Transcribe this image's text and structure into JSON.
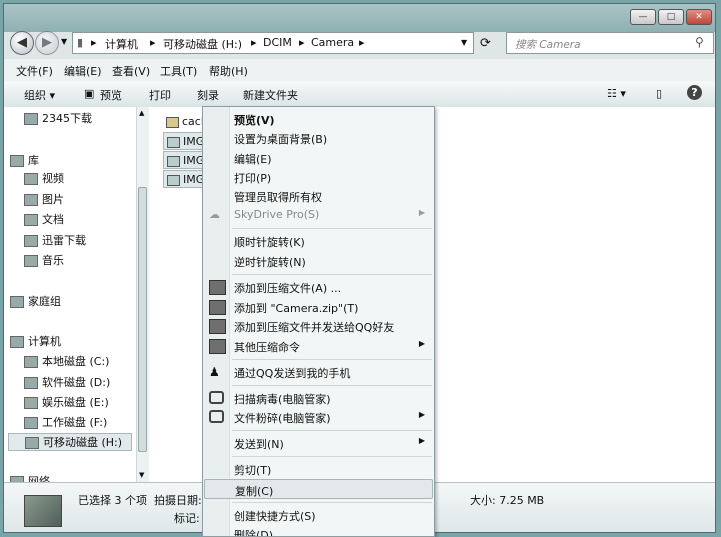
{
  "address": {
    "path": [
      "计算机",
      "可移动磁盘 (H:)",
      "DCIM",
      "Camera"
    ],
    "search_placeholder": "搜索 Camera"
  },
  "menubar": [
    "文件(F)",
    "编辑(E)",
    "查看(V)",
    "工具(T)",
    "帮助(H)"
  ],
  "toolbar": {
    "organize": "组织 ▾",
    "preview": "预览",
    "print": "打印",
    "burn": "刻录",
    "new_folder": "新建文件夹"
  },
  "nav": {
    "items": [
      "2345下载",
      "库",
      "视频",
      "图片",
      "文档",
      "迅雷下载",
      "音乐",
      "家庭组",
      "计算机",
      "本地磁盘 (C:)",
      "软件磁盘 (D:)",
      "娱乐磁盘 (E:)",
      "工作磁盘 (F:)",
      "可移动磁盘 (H:)",
      "网络"
    ]
  },
  "files": [
    "cach",
    "IMG_",
    "IMG_",
    "IMG_"
  ],
  "context_menu": {
    "items": [
      {
        "label": "预览(V)",
        "bold": true
      },
      {
        "label": "设置为桌面背景(B)"
      },
      {
        "label": "编辑(E)"
      },
      {
        "label": "打印(P)"
      },
      {
        "label": "管理员取得所有权"
      },
      {
        "label": "SkyDrive Pro(S)",
        "disabled": true,
        "submenu": true
      },
      {
        "label": "顺时针旋转(K)"
      },
      {
        "label": "逆时针旋转(N)"
      },
      {
        "label": "添加到压缩文件(A) ..."
      },
      {
        "label": "添加到 \"Camera.zip\"(T)"
      },
      {
        "label": "添加到压缩文件并发送给QQ好友"
      },
      {
        "label": "其他压缩命令",
        "submenu": true
      },
      {
        "label": "通过QQ发送到我的手机"
      },
      {
        "label": "扫描病毒(电脑管家)"
      },
      {
        "label": "文件粉碎(电脑管家)",
        "submenu": true
      },
      {
        "label": "发送到(N)",
        "submenu": true
      },
      {
        "label": "剪切(T)"
      },
      {
        "label": "复制(C)",
        "highlight": true
      },
      {
        "label": "创建快捷方式(S)"
      },
      {
        "label": "删除(D)"
      }
    ]
  },
  "status": {
    "selected": "已选择 3 个项",
    "shot_date": "拍摄日期:",
    "tags": "标记:",
    "size": "大小: 7.25 MB"
  }
}
